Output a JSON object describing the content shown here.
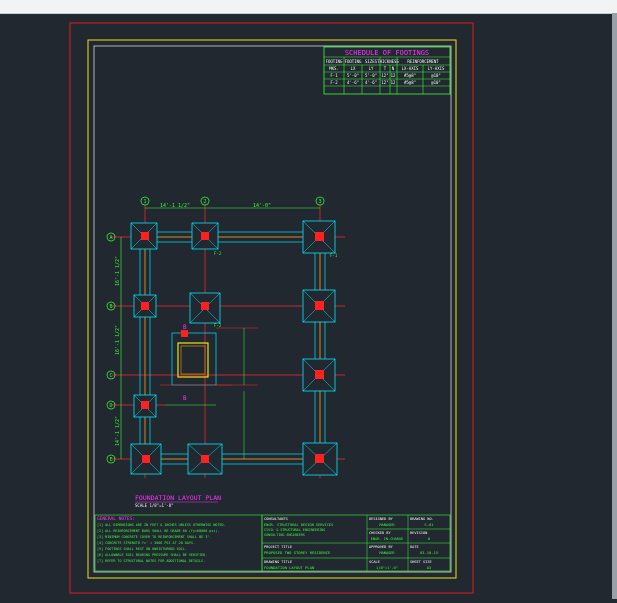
{
  "schedule": {
    "title": "SCHEDULE OF FOOTINGS",
    "headers": [
      "FOOTING",
      "FOOTING",
      "SIZES",
      "THICKNESS",
      "REINFORCEMENT"
    ],
    "subheaders": [
      "MKS.",
      "LX",
      "LY",
      "T",
      "N",
      "LX-AXIS",
      "LY-AXIS"
    ],
    "rows": [
      [
        "F-1",
        "5'-0\"",
        "5'-0\"",
        "12\"",
        "12",
        "#5@8\"",
        "@10\""
      ],
      [
        "F-2",
        "4'-6\"",
        "4'-6\"",
        "12\"",
        "12",
        "#5@8\"",
        "@10\""
      ]
    ]
  },
  "grid": {
    "columns": [
      "1",
      "2",
      "3"
    ],
    "rows": [
      "A",
      "B",
      "C",
      "D",
      "E"
    ],
    "top_dims": [
      "14'-1 1/2\"",
      "14'-0\""
    ],
    "left_dims": [
      "16'-1 1/2\"",
      "16'-1 1/2\"",
      "14'-1 1/2\""
    ]
  },
  "footing_labels": {
    "f1": "F-1",
    "f2": "F-2"
  },
  "section_marker": "B",
  "plan_title": "FOUNDATION LAYOUT PLAN",
  "plan_scale": "SCALE 1/8\"=1'-0\"",
  "notes": {
    "title": "GENERAL NOTES:",
    "lines": [
      "[1] ALL DIMENSIONS ARE IN FEET & INCHES UNLESS OTHERWISE NOTED.",
      "[2] ALL REINFORCEMENT BARS SHALL BE GRADE 60 (fy=60000 psi).",
      "[3] MINIMUM CONCRETE COVER TO REINFORCEMENT SHALL BE 3\".",
      "[4] CONCRETE STRENGTH fc' = 3000 PSI AT 28 DAYS.",
      "[5] FOOTINGS SHALL REST ON UNDISTURBED SOIL.",
      "[6] ALLOWABLE SOIL BEARING PRESSURE SHALL BE VERIFIED.",
      "[7] REFER TO STRUCTURAL NOTES FOR ADDITIONAL DETAILS."
    ]
  },
  "title_block": {
    "consultants_label": "CONSULTANTS",
    "consultants": [
      "ENGR. STRUCTURAL DESIGN SERVICES",
      "CIVIL & STRUCTURAL ENGINEERING",
      "CONSULTING ENGINEERS"
    ],
    "project_label": "PROJECT TITLE",
    "project": "PROPOSED TWO STOREY RESIDENCE",
    "drawing_label": "DRAWING TITLE",
    "drawing": "FOUNDATION LAYOUT PLAN",
    "designed_label": "DESIGNED BY",
    "designed": "MANAGER",
    "checked_label": "CHECKED BY",
    "checked": "ENGR. IN-CHARGE",
    "approved_label": "APPROVED BY",
    "approved": "MANAGER",
    "scale_label": "SCALE",
    "scale": "1/8\"=1'-0\"",
    "drawing_no_label": "DRAWING NO.",
    "drawing_no": "S-01",
    "revision_label": "REVISION",
    "revision": "0",
    "date_label": "DATE",
    "date": "03-10-15",
    "sheet_label": "SHEET SIZE",
    "sheet": "A3"
  },
  "colors": {
    "background": "#212830",
    "frame": "#e31b1b",
    "border": "#e6e619",
    "grid": "#ff2a2a",
    "footing": "#00e5ff",
    "column": "#ff2020",
    "wall": "#e6e619",
    "text_green": "#39ff39",
    "text_magenta": "#ff33ff",
    "white": "#ffffff"
  }
}
